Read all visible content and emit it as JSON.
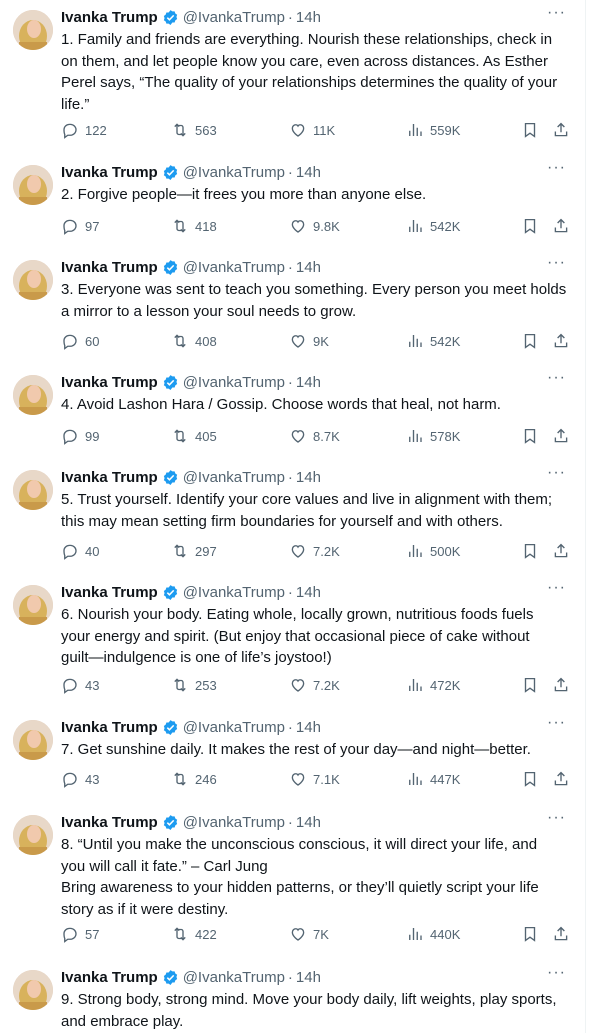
{
  "author": {
    "name": "Ivanka Trump",
    "handle": "@IvankaTrump",
    "time": "14h",
    "separator": "·",
    "more": "···"
  },
  "colors": {
    "text": "#0f1419",
    "muted": "#536471",
    "verified": "#1d9bf0",
    "divider": "#eff3f4"
  },
  "icons": [
    "verified-badge-icon",
    "reply-icon",
    "retweet-icon",
    "like-icon",
    "views-icon",
    "bookmark-icon",
    "share-icon",
    "more-icon"
  ],
  "tweets": [
    {
      "text": "1. Family and friends are everything. Nourish these relationships, check in\non them, and let people know you care, even across distances. As Esther\nPerel says, “The quality of your relationships determines the quality of your\nlife.”",
      "replies": "122",
      "retweets": "563",
      "likes": "11K",
      "views": "559K"
    },
    {
      "text": "2. Forgive people—it frees you more than anyone else.",
      "replies": "97",
      "retweets": "418",
      "likes": "9.8K",
      "views": "542K"
    },
    {
      "text": "3. Everyone was sent to teach you something. Every person you meet holds\na mirror to a lesson your soul needs to grow.",
      "replies": "60",
      "retweets": "408",
      "likes": "9K",
      "views": "542K"
    },
    {
      "text": "4. Avoid Lashon Hara / Gossip. Choose words that heal, not harm.",
      "replies": "99",
      "retweets": "405",
      "likes": "8.7K",
      "views": "578K"
    },
    {
      "text": "5. Trust yourself. Identify your core values and live in alignment with them;\nthis may mean setting firm boundaries for yourself and with others.",
      "replies": "40",
      "retweets": "297",
      "likes": "7.2K",
      "views": "500K"
    },
    {
      "text": "6. Nourish your body. Eating whole, locally grown, nutritious foods fuels\nyour energy and spirit. (But enjoy that occasional piece of cake without\nguilt—indulgence is one of life’s joystoo!)",
      "replies": "43",
      "retweets": "253",
      "likes": "7.2K",
      "views": "472K"
    },
    {
      "text": "7. Get sunshine daily. It makes the rest of your day—and night—better.",
      "replies": "43",
      "retweets": "246",
      "likes": "7.1K",
      "views": "447K"
    },
    {
      "text": "8. “Until you make the unconscious conscious, it will direct your life, and\nyou will call it fate.” – Carl Jung\nBring awareness to your hidden patterns, or they’ll quietly script your life\nstory as if it were destiny.",
      "replies": "57",
      "retweets": "422",
      "likes": "7K",
      "views": "440K"
    },
    {
      "text": "9. Strong body, strong mind. Move your body daily, lift weights, play sports,\nand embrace play.",
      "replies": "",
      "retweets": "",
      "likes": "",
      "views": ""
    }
  ]
}
